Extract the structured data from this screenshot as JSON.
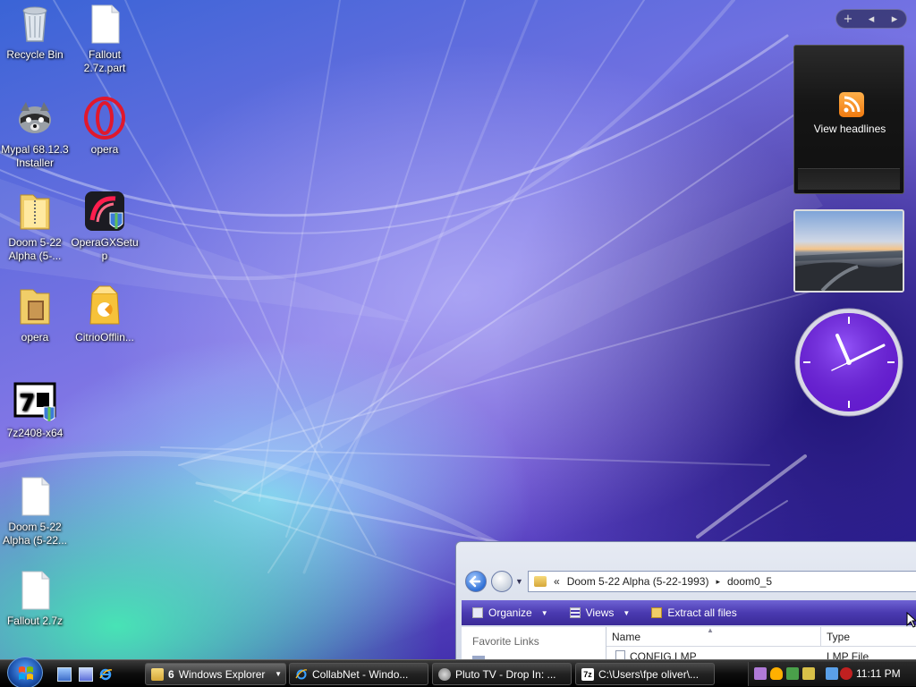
{
  "desktop": {
    "icons": [
      {
        "label": "Recycle Bin",
        "icon": "recycle-bin-icon"
      },
      {
        "label": "Fallout 2.7z.part",
        "icon": "document-icon"
      },
      {
        "label": "Mypal 68.12.3 Installer",
        "icon": "raccoon-installer-icon"
      },
      {
        "label": "opera",
        "icon": "opera-icon"
      },
      {
        "label": "Doom 5-22 Alpha (5-...",
        "icon": "zip-folder-icon"
      },
      {
        "label": "OperaGXSetup",
        "icon": "opera-gx-setup-icon"
      },
      {
        "label": "opera",
        "icon": "folder-icon"
      },
      {
        "label": "CitrioOfflin...",
        "icon": "citrio-installer-icon"
      },
      {
        "label": "7z2408-x64",
        "icon": "7zip-installer-icon"
      },
      {
        "label": "Doom 5-22 Alpha (5-22...",
        "icon": "document-icon"
      },
      {
        "label": "Fallout 2.7z",
        "icon": "document-icon"
      }
    ]
  },
  "sidebar": {
    "controls": [
      "+",
      "◂",
      "▸"
    ],
    "feed_gadget": {
      "label": "View headlines",
      "icon": "rss-feed-icon"
    },
    "clock_time": "11:11"
  },
  "explorer": {
    "breadcrumb": {
      "prefix": "«",
      "parts": [
        "Doom 5-22 Alpha (5-22-1993)",
        "doom0_5"
      ],
      "separator": "▸"
    },
    "toolbar": {
      "organize": "Organize",
      "views": "Views",
      "extract": "Extract all files"
    },
    "nav_pane": {
      "favorite_links": "Favorite Links"
    },
    "columns": {
      "name": "Name",
      "type": "Type"
    },
    "files": [
      {
        "name": "CONFIG.LMP",
        "type": "LMP File"
      }
    ]
  },
  "taskbar": {
    "buttons": [
      {
        "count": "6",
        "label": "Windows Explorer",
        "icon": "folder-icon",
        "has_menu": true
      },
      {
        "label": "CollabNet - Windo...",
        "icon": "ie-icon"
      },
      {
        "label": "Pluto TV - Drop In: ...",
        "icon": "mypal-icon"
      },
      {
        "label": "C:\\Users\\fpe oliver\\...",
        "icon": "7zip-icon"
      }
    ],
    "clock": "11:11 PM"
  },
  "colors": {
    "taskbar": "#000000",
    "explorer_toolbar": "#4a3ab0",
    "clock_face": "#6a1ed8"
  }
}
